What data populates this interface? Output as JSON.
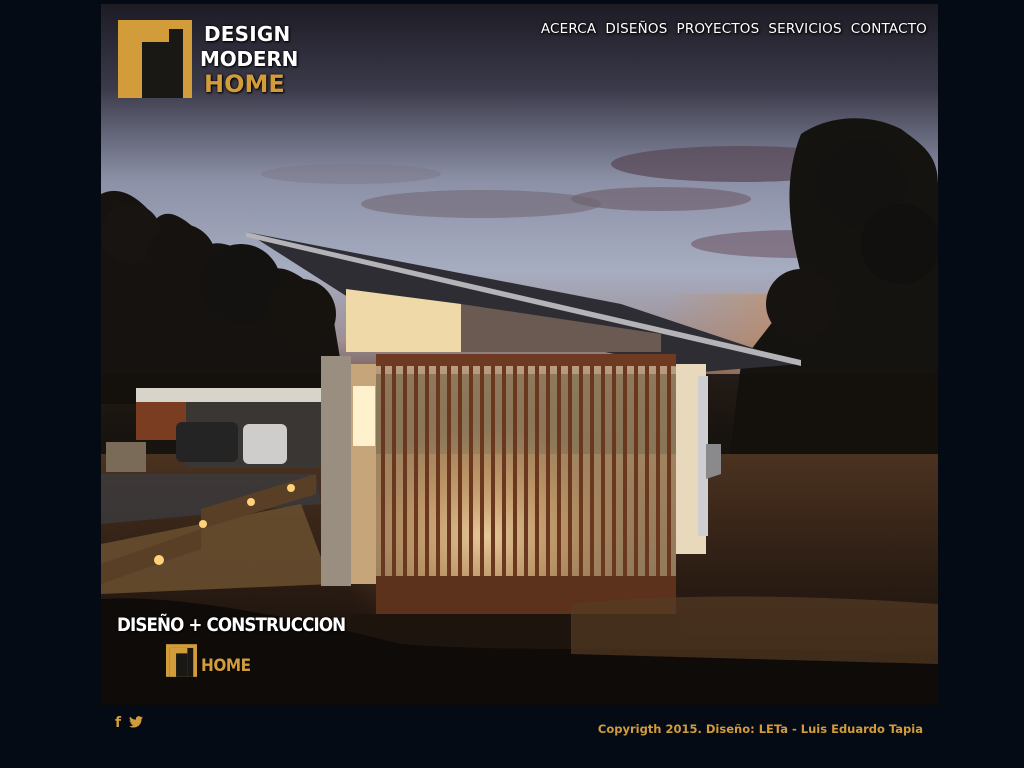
{
  "logo": {
    "line1": "DESIGN",
    "line2": "MODERN",
    "line3": "HOME"
  },
  "nav": {
    "items": [
      "ACERCA",
      "DISEÑOS",
      "PROYECTOS",
      "SERVICIOS",
      "CONTACTO"
    ]
  },
  "tagline": {
    "title": "DISEÑO + CONSTRUCCION",
    "brand": "HOME"
  },
  "footer": {
    "social": {
      "facebook": "f",
      "twitter": "twitter-icon"
    },
    "copyright": "Copyrigth 2015. Diseño: LETa - Luis Eduardo Tapia"
  },
  "colors": {
    "background": "#050b15",
    "accent": "#d29c3b",
    "text": "#ffffff"
  }
}
